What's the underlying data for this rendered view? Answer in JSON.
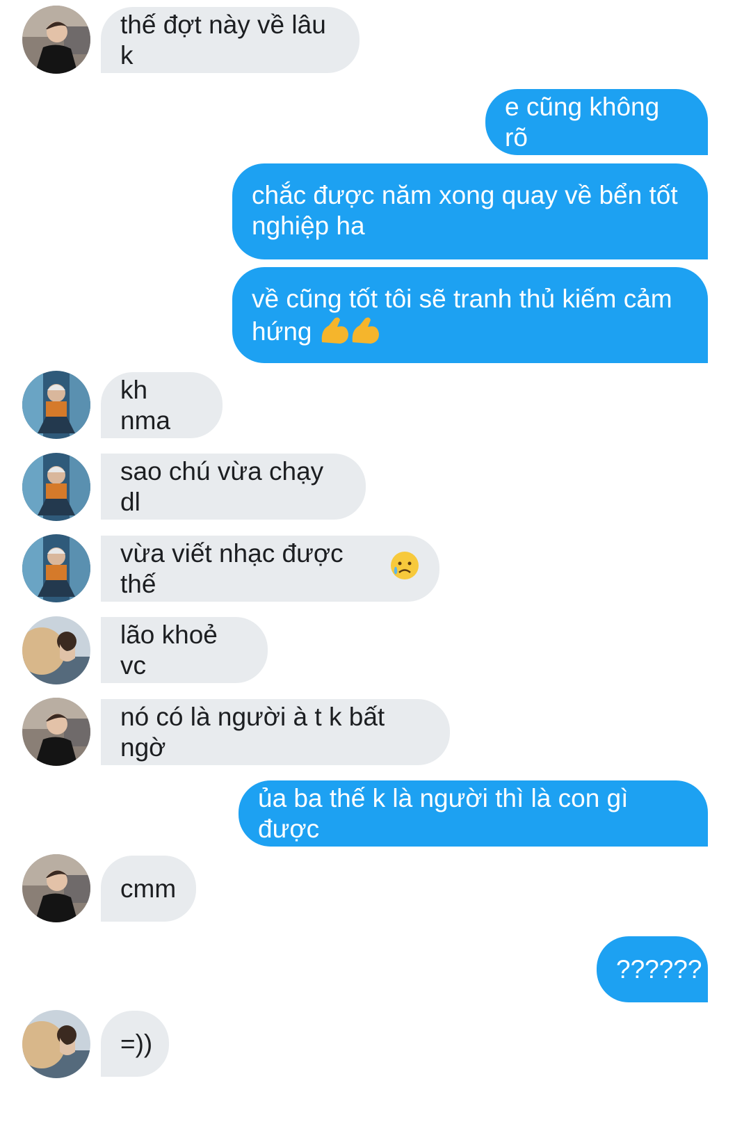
{
  "messages": [
    {
      "side": "in",
      "avatar": "boy-black-suit",
      "text": "thế đợt này về lâu k"
    },
    {
      "side": "out",
      "text": "e cũng không rõ"
    },
    {
      "side": "out",
      "text": "chắc được năm xong quay về bển tốt nghiệp ha"
    },
    {
      "side": "out",
      "text": "về cũng tốt tôi sẽ tranh thủ kiếm cảm hứng",
      "emoji": "flexed-biceps-icon x2"
    },
    {
      "side": "in",
      "avatar": "man-sitting-jersey",
      "text": "kh nma"
    },
    {
      "side": "in",
      "avatar": "man-sitting-jersey",
      "text": "sao chú vừa chạy dl"
    },
    {
      "side": "in",
      "avatar": "man-sitting-jersey",
      "text": "vừa viết nhạc được thế",
      "emoji": "sad-but-relieved-face-icon"
    },
    {
      "side": "in",
      "avatar": "girl-fur-coat",
      "text": "lão khoẻ vc"
    },
    {
      "side": "in",
      "avatar": "boy-black-suit",
      "text": "nó có là người à t k bất ngờ"
    },
    {
      "side": "out",
      "text": "ủa ba thế k là người thì là con gì được"
    },
    {
      "side": "in",
      "avatar": "boy-black-suit",
      "text": "cmm"
    },
    {
      "side": "out",
      "text": "??????"
    },
    {
      "side": "in",
      "avatar": "girl-fur-coat",
      "text": "=))"
    }
  ],
  "colors": {
    "outgoing": "#1da1f2",
    "incoming": "#e8ebee",
    "incoming_text": "#1c1e21"
  }
}
